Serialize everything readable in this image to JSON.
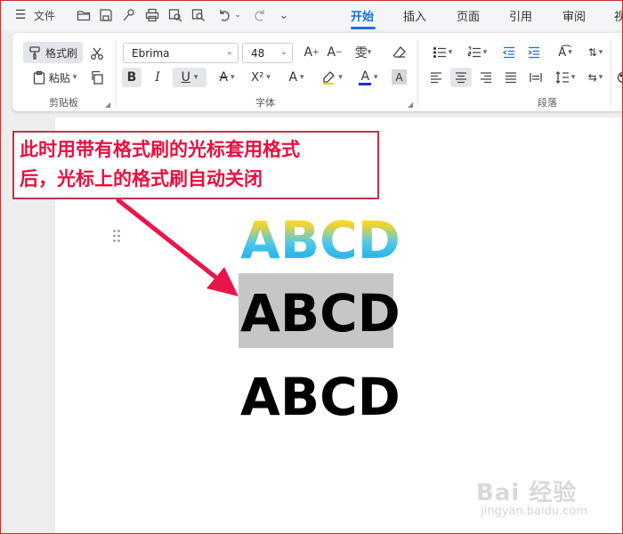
{
  "menu": {
    "file_label": "文件",
    "tabs": [
      {
        "label": "开始",
        "active": true
      },
      {
        "label": "插入",
        "active": false
      },
      {
        "label": "页面",
        "active": false
      },
      {
        "label": "引用",
        "active": false
      },
      {
        "label": "审阅",
        "active": false
      },
      {
        "label": "视",
        "active": false
      }
    ]
  },
  "ribbon": {
    "format_painter_label": "格式刷",
    "paste_label": "粘贴",
    "clipboard_group_label": "剪贴板",
    "font_name": "Ebrima",
    "font_size": "48",
    "font_group_label": "字体",
    "paragraph_group_label": "段落",
    "bold_label": "B",
    "italic_label": "I",
    "underline_label": "U",
    "strikethrough_label": "A",
    "superscript_label": "X²",
    "font_effect_label": "A",
    "highlight_label": "A",
    "font_color_label": "A",
    "char_shading_label": "A"
  },
  "document": {
    "line1": "ABCD",
    "line2": "ABCD",
    "line3": "ABCD"
  },
  "callout": {
    "line1": "此时用带有格式刷的光标套用格式",
    "line2": "后，光标上的格式刷自动关闭"
  },
  "colors": {
    "accent": "#1a6fd8",
    "callout_red": "#e8103f",
    "selection_gray": "#c6c6c6",
    "font_color_bar": "#1a2fd0"
  },
  "watermark": {
    "text": "Bai  经验",
    "sub": "jingyan.baidu.com"
  }
}
